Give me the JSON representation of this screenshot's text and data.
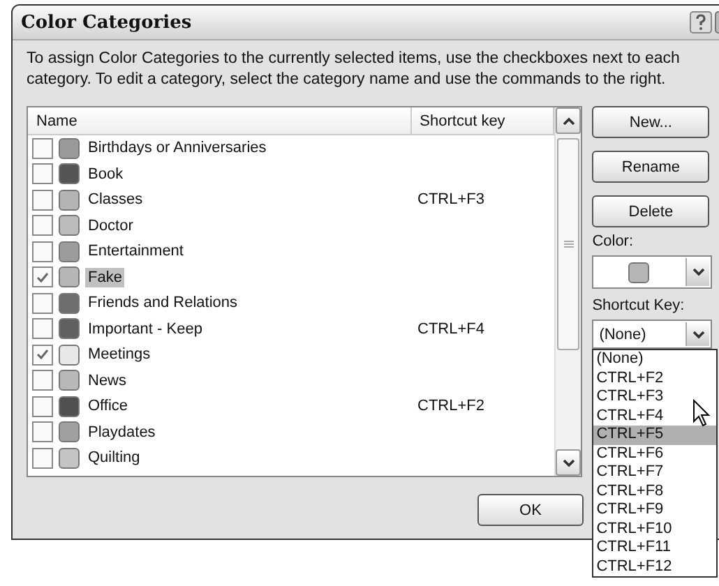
{
  "window": {
    "title": "Color Categories"
  },
  "description": "To assign Color Categories to the currently selected items, use the checkboxes next to each category.  To edit a category, select the category name and use the commands to the right.",
  "table": {
    "columns": [
      "Name",
      "Shortcut key"
    ],
    "rows": [
      {
        "name": "Birthdays or Anniversaries",
        "shortcut": "",
        "checked": false,
        "selected": false,
        "color": "#9a9a9a"
      },
      {
        "name": "Book",
        "shortcut": "",
        "checked": false,
        "selected": false,
        "color": "#555555"
      },
      {
        "name": "Classes",
        "shortcut": "CTRL+F3",
        "checked": false,
        "selected": false,
        "color": "#b4b4b4"
      },
      {
        "name": "Doctor",
        "shortcut": "",
        "checked": false,
        "selected": false,
        "color": "#bcbcbc"
      },
      {
        "name": "Entertainment",
        "shortcut": "",
        "checked": false,
        "selected": false,
        "color": "#9c9c9c"
      },
      {
        "name": "Fake",
        "shortcut": "",
        "checked": true,
        "selected": true,
        "color": "#b6b6b6"
      },
      {
        "name": "Friends and Relations",
        "shortcut": "",
        "checked": false,
        "selected": false,
        "color": "#6e6e6e"
      },
      {
        "name": "Important - Keep",
        "shortcut": "CTRL+F4",
        "checked": false,
        "selected": false,
        "color": "#606060"
      },
      {
        "name": "Meetings",
        "shortcut": "",
        "checked": true,
        "selected": false,
        "color": "#e8e8e8"
      },
      {
        "name": "News",
        "shortcut": "",
        "checked": false,
        "selected": false,
        "color": "#b8b8b8"
      },
      {
        "name": "Office",
        "shortcut": "CTRL+F2",
        "checked": false,
        "selected": false,
        "color": "#505050"
      },
      {
        "name": "Playdates",
        "shortcut": "",
        "checked": false,
        "selected": false,
        "color": "#a0a0a0"
      },
      {
        "name": "Quilting",
        "shortcut": "",
        "checked": false,
        "selected": false,
        "color": "#c4c4c4"
      }
    ]
  },
  "buttons": [
    "New...",
    "Rename",
    "Delete"
  ],
  "color_label": "Color:",
  "shortcut_label": "Shortcut Key:",
  "shortcut_value": "(None)",
  "shortcut_options": [
    {
      "label": "(None)",
      "selected": false
    },
    {
      "label": "CTRL+F2",
      "selected": false
    },
    {
      "label": "CTRL+F3",
      "selected": false
    },
    {
      "label": "CTRL+F4",
      "selected": false
    },
    {
      "label": "CTRL+F5",
      "selected": true
    },
    {
      "label": "CTRL+F6",
      "selected": false
    },
    {
      "label": "CTRL+F7",
      "selected": false
    },
    {
      "label": "CTRL+F8",
      "selected": false
    },
    {
      "label": "CTRL+F9",
      "selected": false
    },
    {
      "label": "CTRL+F10",
      "selected": false
    },
    {
      "label": "CTRL+F11",
      "selected": false
    },
    {
      "label": "CTRL+F12",
      "selected": false
    }
  ],
  "ok_button": "OK"
}
